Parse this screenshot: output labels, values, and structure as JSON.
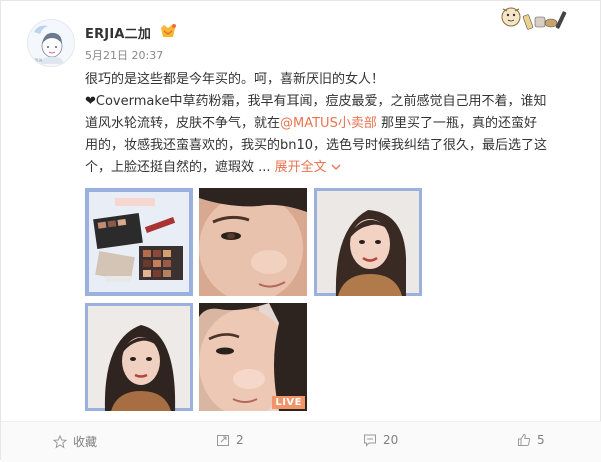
{
  "post": {
    "user_name": "ERJIA二加",
    "timestamp": "5月21日 20:37",
    "line1": "很巧的是这些都是今年买的。呵，喜新厌旧的女人！",
    "line2": "Covermake中草药粉霜，我早有耳闻，痘皮最爱，之前感觉自己用不着，谁知",
    "line3a": "道风水轮流转，皮肤不争气，就在",
    "mention": "@MATUS小卖部",
    "line3b": " 那里买了一瓶，真的还蛮好",
    "line4": "用的，妆感我还蛮喜欢的，我买的bn10，选色号时候我纠结了很久，最后选了这",
    "line5": "个，上脸还挺自然的，遮瑕效 ...",
    "expand_label": "展开全文",
    "live_label": "LIVE"
  },
  "footer": {
    "favorite_label": "收藏",
    "repost_count": "2",
    "comment_count": "20",
    "like_count": "5"
  },
  "icons": {
    "avatar": "avatar-illustration",
    "vip": "vip-badge-icon",
    "sticker": "sticker-decoration",
    "heart": "black-heart",
    "expand": "chevron-down-icon",
    "favorite": "star-icon",
    "repost": "repost-icon",
    "comment": "comment-icon",
    "like": "thumbs-up-icon"
  },
  "colors": {
    "accent": "#eb7350",
    "text": "#333333",
    "muted": "#808080",
    "image_border": "#8fa8d8"
  }
}
